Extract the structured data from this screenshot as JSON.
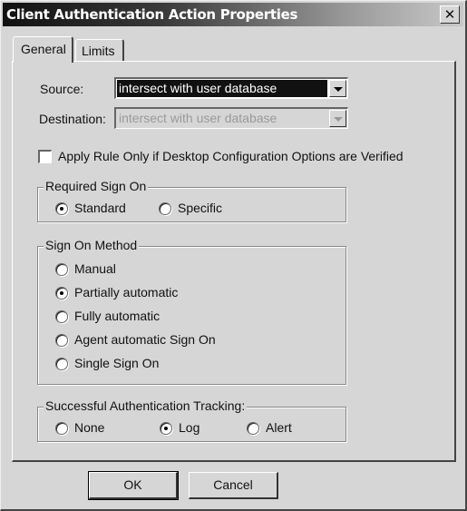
{
  "window": {
    "title": "Client Authentication Action Properties",
    "close_icon": "close-icon"
  },
  "tabs": [
    {
      "label": "General",
      "active": true
    },
    {
      "label": "Limits",
      "active": false
    }
  ],
  "general": {
    "source": {
      "label": "Source:",
      "value": "intersect with user database",
      "enabled": true
    },
    "destination": {
      "label": "Destination:",
      "value": "intersect with user database",
      "enabled": false
    },
    "apply_rule": {
      "label": "Apply Rule Only if Desktop Configuration Options are Verified",
      "checked": false
    },
    "required_sign_on": {
      "title": "Required Sign On",
      "options": [
        {
          "label": "Standard",
          "checked": true
        },
        {
          "label": "Specific",
          "checked": false
        }
      ]
    },
    "sign_on_method": {
      "title": "Sign On Method",
      "options": [
        {
          "label": "Manual",
          "checked": false
        },
        {
          "label": "Partially automatic",
          "checked": true
        },
        {
          "label": "Fully automatic",
          "checked": false
        },
        {
          "label": "Agent automatic Sign On",
          "checked": false
        },
        {
          "label": "Single Sign On",
          "checked": false
        }
      ]
    },
    "tracking": {
      "title": "Successful Authentication Tracking:",
      "options": [
        {
          "label": "None",
          "checked": false
        },
        {
          "label": "Log",
          "checked": true
        },
        {
          "label": "Alert",
          "checked": false
        }
      ]
    }
  },
  "buttons": {
    "ok": "OK",
    "cancel": "Cancel"
  }
}
